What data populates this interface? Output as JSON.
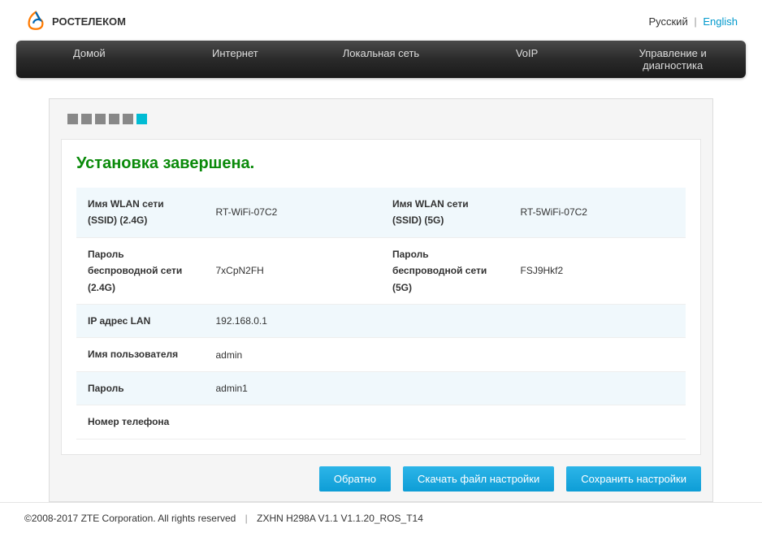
{
  "header": {
    "logo_text": "РОСТЕЛЕКОМ",
    "lang_ru": "Русский",
    "lang_en": "English"
  },
  "nav": {
    "home": "Домой",
    "internet": "Интернет",
    "lan": "Локальная сеть",
    "voip": "VoIP",
    "diagnostics": "Управление и диагностика"
  },
  "wizard": {
    "title": "Установка завершена.",
    "labels": {
      "ssid_24": "Имя WLAN сети (SSID) (2.4G)",
      "ssid_5": "Имя WLAN сети (SSID) (5G)",
      "pass_24": "Пароль беспроводной сети (2.4G)",
      "pass_5": "Пароль беспроводной сети (5G)",
      "ip_lan": "IP адрес LAN",
      "username": "Имя пользователя",
      "password": "Пароль",
      "phone": "Номер телефона"
    },
    "values": {
      "ssid_24": "RT-WiFi-07C2",
      "ssid_5": "RT-5WiFi-07C2",
      "pass_24": "7xCpN2FH",
      "pass_5": "FSJ9Hkf2",
      "ip_lan": "192.168.0.1",
      "username": "admin",
      "password": "admin1",
      "phone": ""
    },
    "buttons": {
      "back": "Обратно",
      "download": "Скачать файл настройки",
      "save": "Сохранить настройки"
    }
  },
  "footer": {
    "copyright": "©2008-2017 ZTE Corporation. All rights reserved",
    "model": "ZXHN H298A V1.1 V1.1.20_ROS_T14"
  }
}
